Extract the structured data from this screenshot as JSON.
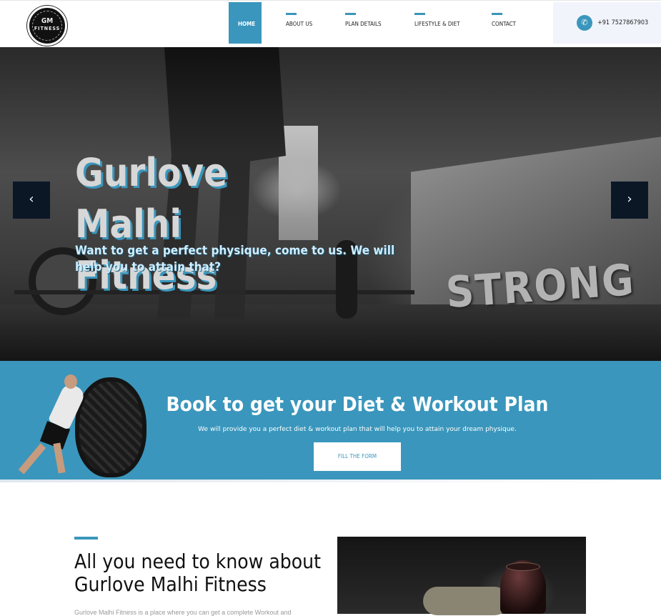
{
  "header": {
    "logo": {
      "line1": "GM",
      "line2": "FITNESS"
    },
    "nav": [
      {
        "label": "HOME",
        "active": true
      },
      {
        "label": "ABOUT US",
        "active": false
      },
      {
        "label": "PLAN DETAILS",
        "active": false
      },
      {
        "label": "LIFESTYLE & DIET",
        "active": false
      },
      {
        "label": "CONTACT",
        "active": false
      }
    ],
    "phone": "+91 7527867903"
  },
  "hero": {
    "title": "Gurlove Malhi Fitness",
    "subtitle": "Want to get a perfect physique, come to us. We will help you to attain that?",
    "box_text": "STRONG",
    "prev_arrow": "‹",
    "next_arrow": "›"
  },
  "cta": {
    "title": "Book to get your Diet & Workout Plan",
    "description": "We will provide you a perfect diet & workout plan that will help you to attain your dream physique.",
    "button": "FILL THE FORM"
  },
  "about": {
    "title": "All you need to know about Gurlove Malhi Fitness",
    "text": "Gurlove Malhi Fitness is a place where you can get a complete Workout and"
  },
  "colors": {
    "accent": "#3a96bc",
    "dark": "#0c1726"
  }
}
